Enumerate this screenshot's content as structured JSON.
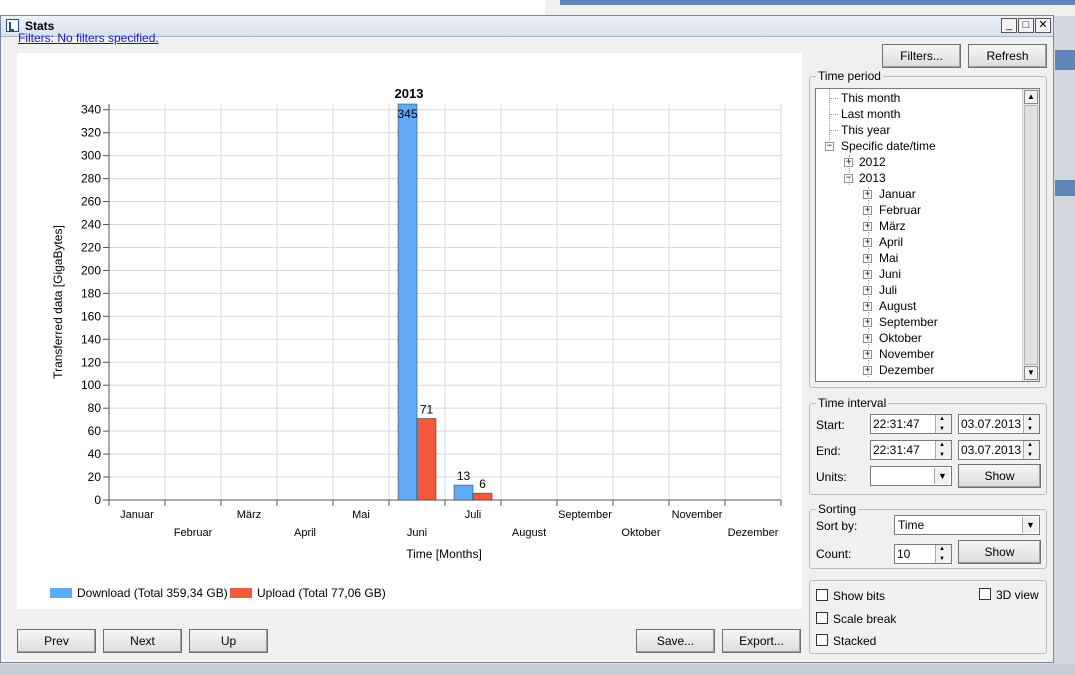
{
  "window": {
    "title": "Stats",
    "controls": {
      "minimize": "_",
      "maximize": "□",
      "close": "✕"
    }
  },
  "filters_link": "Filters: No filters specified.",
  "toolbar": {
    "filters": "Filters...",
    "refresh": "Refresh"
  },
  "chart_data": {
    "type": "bar",
    "title": "2013",
    "xlabel": "Time [Months]",
    "ylabel": "Transferred data [GigaBytes]",
    "categories": [
      "Januar",
      "Februar",
      "März",
      "April",
      "Mai",
      "Juni",
      "Juli",
      "August",
      "September",
      "Oktober",
      "November",
      "Dezember"
    ],
    "series": [
      {
        "name": "Download (Total 359,34 GB)",
        "color": "#5eaaf7",
        "values": [
          0,
          0,
          0,
          0,
          0,
          345,
          13,
          0,
          0,
          0,
          0,
          0
        ]
      },
      {
        "name": "Upload (Total 77,06 GB)",
        "color": "#f25a3a",
        "values": [
          0,
          0,
          0,
          0,
          0,
          71,
          6,
          0,
          0,
          0,
          0,
          0
        ]
      }
    ],
    "yticks": [
      0,
      20,
      40,
      60,
      80,
      100,
      120,
      140,
      160,
      180,
      200,
      220,
      240,
      260,
      280,
      300,
      320,
      340
    ],
    "ylim": [
      0,
      345
    ],
    "grid": true,
    "legend": "bottom-left",
    "data_labels": true
  },
  "time_period": {
    "legend": "Time period",
    "items": [
      {
        "label": "This month",
        "level": 1,
        "expander": null
      },
      {
        "label": "Last month",
        "level": 1,
        "expander": null
      },
      {
        "label": "This year",
        "level": 1,
        "expander": null
      },
      {
        "label": "Specific date/time",
        "level": 1,
        "expander": "−"
      },
      {
        "label": "2012",
        "level": 2,
        "expander": "+"
      },
      {
        "label": "2013",
        "level": 2,
        "expander": "−"
      },
      {
        "label": "Januar",
        "level": 3,
        "expander": "+"
      },
      {
        "label": "Februar",
        "level": 3,
        "expander": "+"
      },
      {
        "label": "März",
        "level": 3,
        "expander": "+"
      },
      {
        "label": "April",
        "level": 3,
        "expander": "+"
      },
      {
        "label": "Mai",
        "level": 3,
        "expander": "+"
      },
      {
        "label": "Juni",
        "level": 3,
        "expander": "+"
      },
      {
        "label": "Juli",
        "level": 3,
        "expander": "+"
      },
      {
        "label": "August",
        "level": 3,
        "expander": "+"
      },
      {
        "label": "September",
        "level": 3,
        "expander": "+"
      },
      {
        "label": "Oktober",
        "level": 3,
        "expander": "+"
      },
      {
        "label": "November",
        "level": 3,
        "expander": "+"
      },
      {
        "label": "Dezember",
        "level": 3,
        "expander": "+"
      }
    ]
  },
  "time_interval": {
    "legend": "Time interval",
    "start_label": "Start:",
    "start_time": "22:31:47",
    "start_date": "03.07.2013",
    "end_label": "End:",
    "end_time": "22:31:47",
    "end_date": "03.07.2013",
    "units_label": "Units:",
    "units_value": "",
    "show": "Show"
  },
  "sorting": {
    "legend": "Sorting",
    "sort_by_label": "Sort by:",
    "sort_by_value": "Time",
    "count_label": "Count:",
    "count_value": "10",
    "show": "Show"
  },
  "options": {
    "show_bits": "Show bits",
    "view_3d": "3D view",
    "scale_break": "Scale break",
    "stacked": "Stacked"
  },
  "bottom": {
    "prev": "Prev",
    "next": "Next",
    "up": "Up",
    "save": "Save...",
    "export": "Export..."
  }
}
